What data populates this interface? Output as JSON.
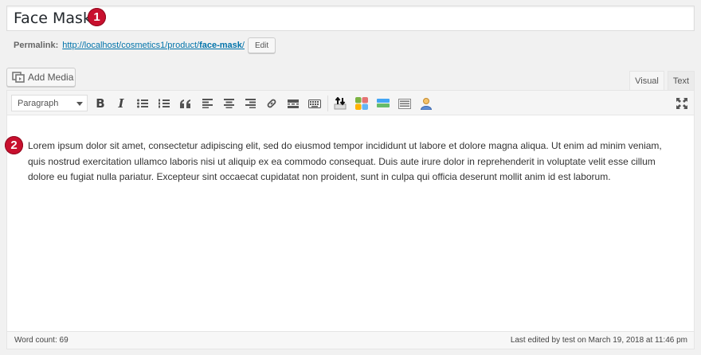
{
  "title": {
    "value": "Face Mask"
  },
  "badges": {
    "first": "1",
    "second": "2"
  },
  "permalink": {
    "label": "Permalink:",
    "url_base": "http://localhost/cosmetics1/product/",
    "slug": "face-mask",
    "url_end": "/",
    "edit_label": "Edit"
  },
  "media": {
    "add_label": "Add Media"
  },
  "tabs": {
    "visual": "Visual",
    "text": "Text"
  },
  "toolbar": {
    "format_value": "Paragraph",
    "icons": [
      "bold-icon",
      "italic-icon",
      "bullet-list-icon",
      "numbered-list-icon",
      "blockquote-icon",
      "align-left-icon",
      "align-center-icon",
      "align-right-icon",
      "link-icon",
      "read-more-icon",
      "toolbar-toggle-icon",
      "plugin-upload-icon",
      "plugin-grid-icon",
      "plugin-layout-icon",
      "plugin-table-icon",
      "plugin-user-icon",
      "fullscreen-icon"
    ],
    "bold": "B",
    "italic": "I"
  },
  "editor": {
    "content": "Lorem ipsum dolor sit amet, consectetur adipiscing elit, sed do eiusmod tempor incididunt ut labore et dolore magna aliqua. Ut enim ad minim veniam, quis nostrud exercitation ullamco laboris nisi ut aliquip ex ea commodo consequat. Duis aute irure dolor in reprehenderit in voluptate velit esse cillum dolore eu fugiat nulla pariatur. Excepteur sint occaecat cupidatat non proident, sunt in culpa qui officia deserunt mollit anim id est laborum."
  },
  "status": {
    "word_count": "Word count: 69",
    "last_edited": "Last edited by test on March 19, 2018 at 11:46 pm"
  },
  "colors": {
    "badge": "#c8102e",
    "link": "#0073aa"
  }
}
